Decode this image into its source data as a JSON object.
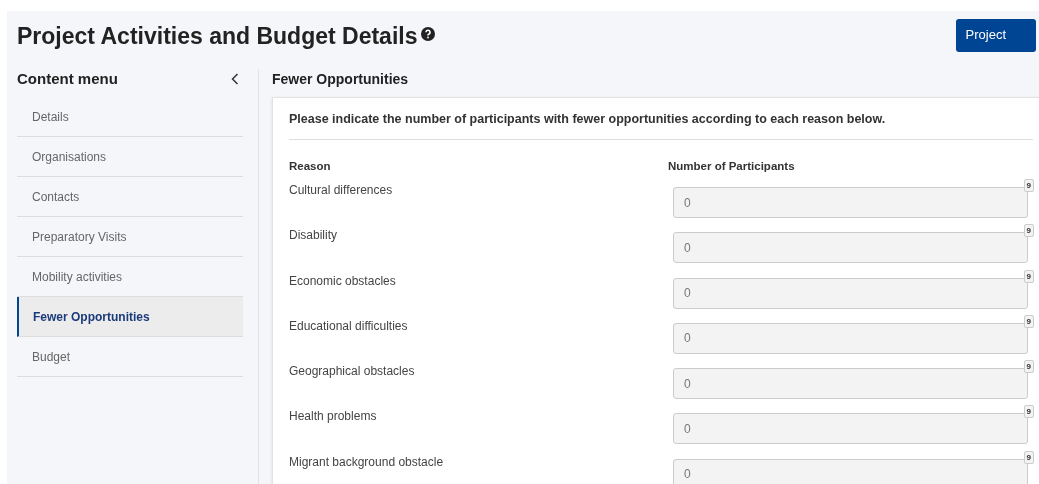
{
  "page": {
    "title": "Project Activities and Budget Details",
    "action_button": "Project"
  },
  "sidebar": {
    "title": "Content menu",
    "items": [
      {
        "label": "Details",
        "selected": false
      },
      {
        "label": "Organisations",
        "selected": false
      },
      {
        "label": "Contacts",
        "selected": false
      },
      {
        "label": "Preparatory Visits",
        "selected": false
      },
      {
        "label": "Mobility activities",
        "selected": false
      },
      {
        "label": "Fewer Opportunities",
        "selected": true
      },
      {
        "label": "Budget",
        "selected": false
      }
    ]
  },
  "section": {
    "title": "Fewer Opportunities",
    "instruction": "Please indicate the number of participants with fewer opportunities according to each reason below.",
    "columns": [
      "Reason",
      "Number of Participants"
    ],
    "rows": [
      {
        "reason": "Cultural differences",
        "value": "0",
        "counter": "9",
        "disabled": true
      },
      {
        "reason": "Disability",
        "value": "0",
        "counter": "9",
        "disabled": true
      },
      {
        "reason": "Economic obstacles",
        "value": "0",
        "counter": "9",
        "disabled": true
      },
      {
        "reason": "Educational difficulties",
        "value": "0",
        "counter": "9",
        "disabled": true
      },
      {
        "reason": "Geographical obstacles",
        "value": "0",
        "counter": "9",
        "disabled": true
      },
      {
        "reason": "Health problems",
        "value": "0",
        "counter": "9",
        "disabled": true
      },
      {
        "reason": "Migrant background obstacle",
        "value": "0",
        "counter": "9",
        "disabled": true
      }
    ]
  }
}
